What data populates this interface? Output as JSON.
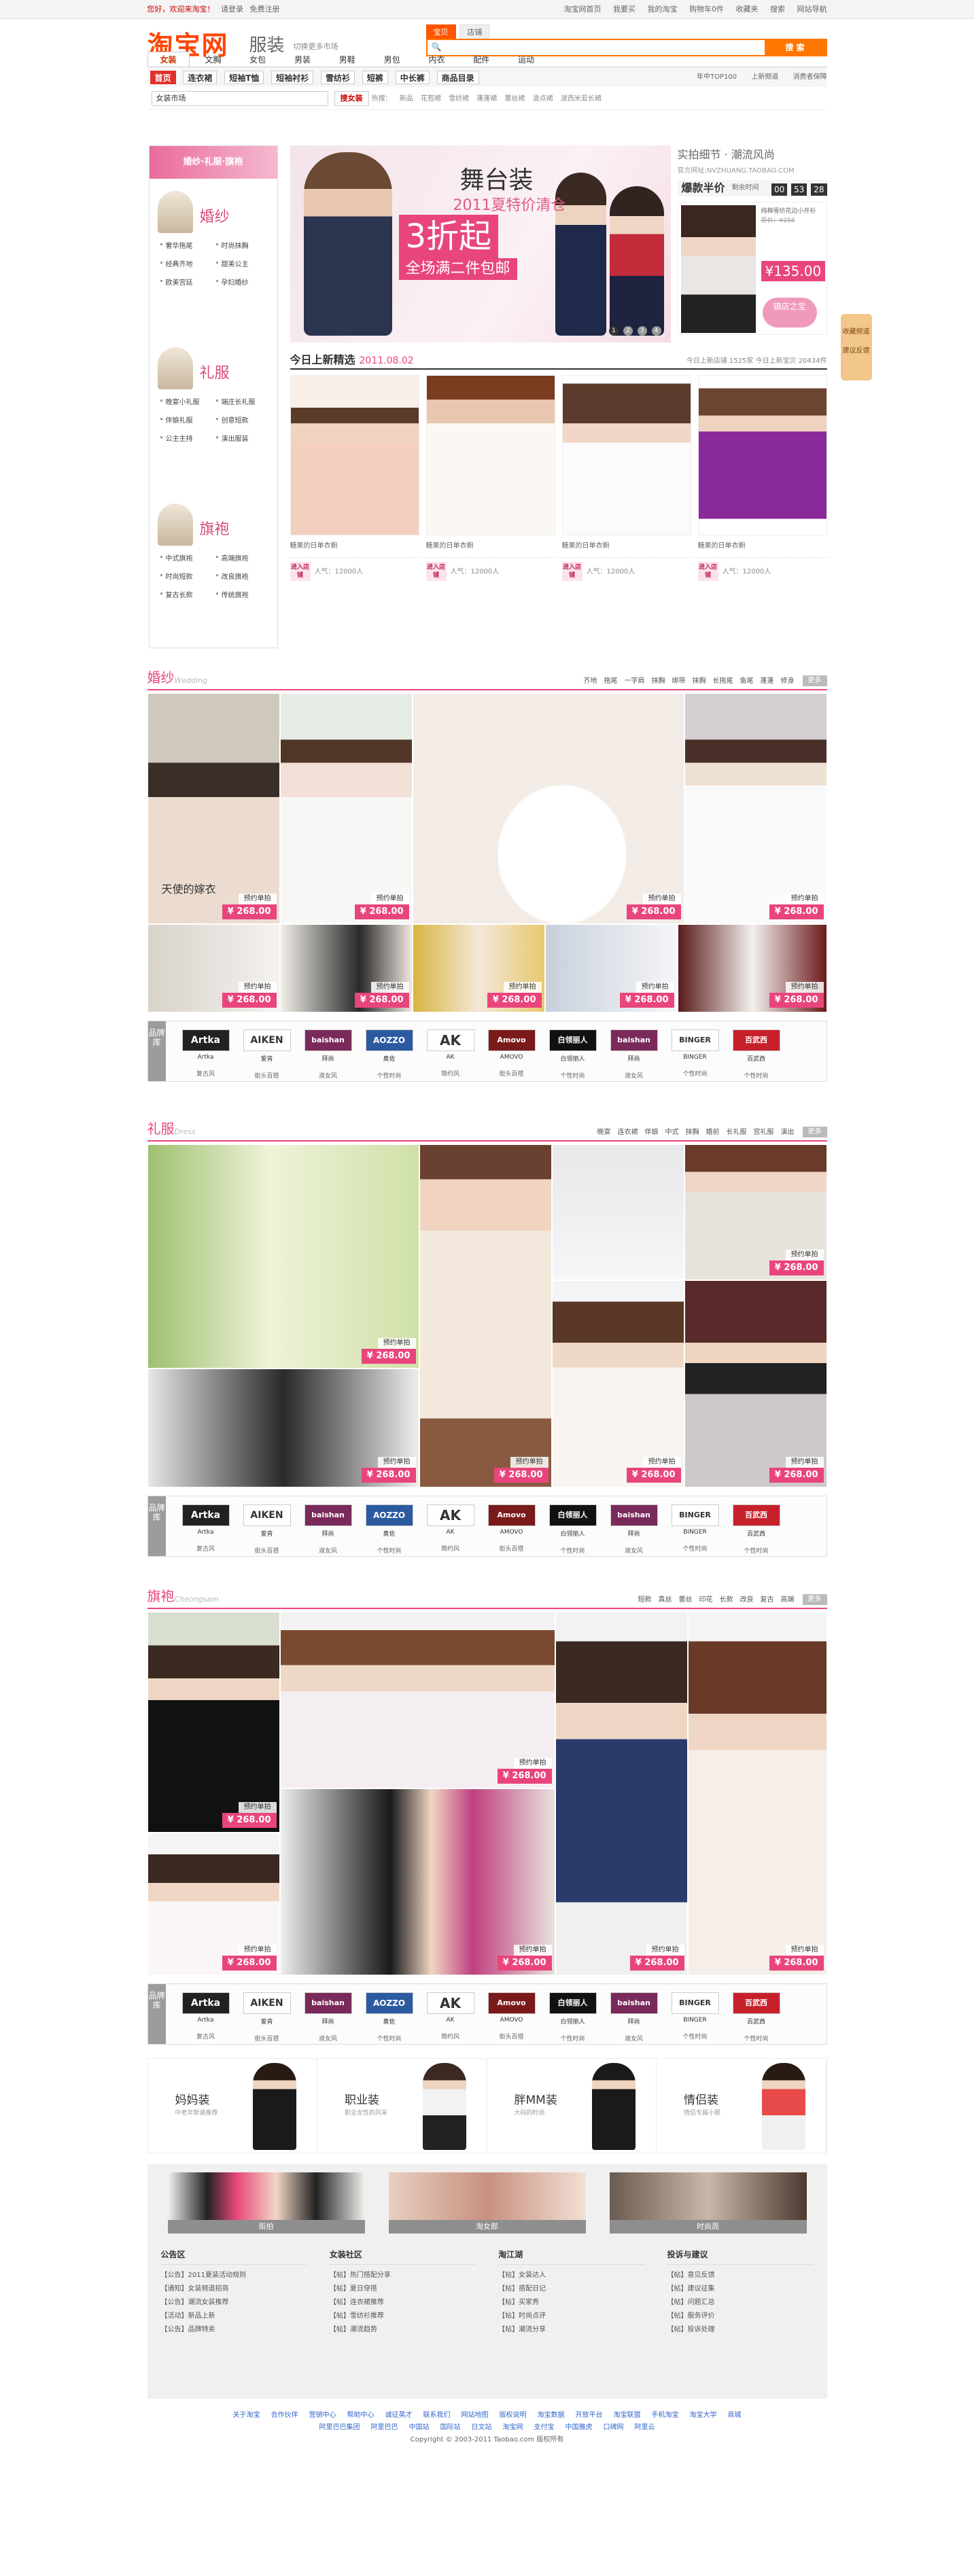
{
  "topbar": {
    "greeting": "您好，欢迎来淘宝！",
    "login": "请登录",
    "register": "免费注册",
    "links": [
      "淘宝网首页",
      "我要买",
      "我的淘宝",
      "购物车0件",
      "收藏夹",
      "搜索",
      "网站导航"
    ]
  },
  "header": {
    "logo": "淘宝网",
    "channel": "服装",
    "switch_market": "切换更多市场",
    "search_tabs": [
      "宝贝",
      "店铺"
    ],
    "search_placeholder": "",
    "search_button": "搜 索"
  },
  "subnav": [
    "女装",
    "文胸",
    "女包",
    "男装",
    "男鞋",
    "男包",
    "内衣",
    "配件",
    "运动"
  ],
  "categories": [
    "首页",
    "连衣裙",
    "短袖T恤",
    "短袖衬衫",
    "雪纺衫",
    "短裤",
    "中长裤",
    "商品目录"
  ],
  "cat_right": [
    "年中TOP100",
    "上新频道",
    "消费者保障"
  ],
  "quickbar": {
    "market": "女装市场",
    "pink": "搜女装",
    "hot_label": "热搜：",
    "hot": [
      "新品",
      "花苞裙",
      "雪纺裙",
      "蓬蓬裙",
      "蕾丝裙",
      "波点裙",
      "波西米亚长裙"
    ]
  },
  "sidebar": {
    "header": "婚纱·礼服·旗袍",
    "groups": [
      {
        "title": "婚纱",
        "items": [
          "奢华拖尾",
          "时尚抹胸",
          "经典齐地",
          "甜美公主",
          "欧美宫廷",
          "孕妇婚纱"
        ]
      },
      {
        "title": "礼服",
        "items": [
          "晚宴小礼服",
          "端庄长礼服",
          "伴娘礼服",
          "创意短款",
          "公主主持",
          "演出服装"
        ]
      },
      {
        "title": "旗袍",
        "items": [
          "中式旗袍",
          "高端旗袍",
          "时尚短款",
          "改良旗袍",
          "复古长款",
          "传统旗袍"
        ]
      }
    ]
  },
  "banner": {
    "title": "舞台装",
    "subtitle": "2011夏特价清仓",
    "discount": "3折起",
    "promo": "全场满二件包邮",
    "pages": [
      "1",
      "2",
      "3",
      "4"
    ]
  },
  "shop": {
    "title": "实拍细节 · 潮流风尚",
    "url": "官方网址:NVZHUANG.TAOBAO.COM",
    "burst": "爆款半价",
    "countdown_label": "剩余时间",
    "countdown": [
      "00",
      "53",
      "28"
    ],
    "desc": "纯棉雪纺花边小开衫",
    "orig": "原价：¥258",
    "price": "¥135.00",
    "btn": "镇店之宝"
  },
  "side_tag": {
    "lines": [
      "收藏频道",
      "建议反馈"
    ]
  },
  "new_section": {
    "title": "今日上新精选",
    "date": "2011.08.02",
    "stats": "今日上新店铺 1525家   今日上新宝贝 20434件",
    "items": [
      {
        "caption": "糖果的日单衣橱",
        "btn": "进入店铺",
        "pop": "人气：12000人"
      },
      {
        "caption": "糖果的日单衣橱",
        "btn": "进入店铺",
        "pop": "人气：12000人"
      },
      {
        "caption": "糖果的日单衣橱",
        "btn": "进入店铺",
        "pop": "人气：12000人"
      },
      {
        "caption": "糖果的日单衣橱",
        "btn": "进入店铺",
        "pop": "人气：12000人"
      }
    ]
  },
  "wedding": {
    "title": "婚纱",
    "en": "Wedding",
    "links": [
      "齐地",
      "拖尾",
      "一字肩",
      "抹胸",
      "绑带",
      "抹胸",
      "长拖尾",
      "鱼尾",
      "蓬蓬",
      "修身"
    ],
    "more": "更多",
    "mark": "天使的嫁衣",
    "tag": "预约单拍",
    "price": "¥ 268.00"
  },
  "dress": {
    "title": "礼服",
    "en": "Dress",
    "links": [
      "晚宴",
      "连衣裙",
      "伴娘",
      "中式",
      "抹胸",
      "婚前",
      "长礼服",
      "宫礼服",
      "演出"
    ],
    "more": "更多",
    "tag": "预约单拍",
    "price": "¥ 268.00"
  },
  "qipao": {
    "title": "旗袍",
    "en": "Cheongsam",
    "links": [
      "短款",
      "真丝",
      "蕾丝",
      "印花",
      "长款",
      "改良",
      "复古",
      "高端"
    ],
    "more": "更多",
    "tag": "预约单拍",
    "price": "¥ 268.00"
  },
  "brands": {
    "label": "品牌库",
    "list": [
      {
        "logo": "Artka",
        "n1": "Artka",
        "n2": "复古风"
      },
      {
        "logo": "AIKEN",
        "n1": "爱肯",
        "n2": "街头百搭"
      },
      {
        "logo": "baishan",
        "n1": "拜尚",
        "n2": "淑女风"
      },
      {
        "logo": "AOZZO",
        "n1": "奥佐",
        "n2": "个性时尚"
      },
      {
        "logo": "AK",
        "n1": "AK",
        "n2": "简约风"
      },
      {
        "logo": "Amovo",
        "n1": "AMOVO",
        "n2": "街头百搭"
      },
      {
        "logo": "白领丽人",
        "n1": "白领丽人",
        "n2": "个性时尚"
      },
      {
        "logo": "baishan",
        "n1": "拜尚",
        "n2": "淑女风"
      },
      {
        "logo": "BINGER",
        "n1": "BINGER",
        "n2": "个性时尚"
      },
      {
        "logo": "百武西",
        "n1": "百武西",
        "n2": "个性时尚"
      }
    ]
  },
  "styles": [
    {
      "name": "妈妈装",
      "desc": "中老年新装推荐"
    },
    {
      "name": "职业装",
      "desc": "职业女性的风采"
    },
    {
      "name": "胖MM装",
      "desc": "大码的时尚"
    },
    {
      "name": "情侣装",
      "desc": "情侣专属小屋"
    }
  ],
  "features": [
    "街拍",
    "淘女郎",
    "时尚周"
  ],
  "boards": [
    {
      "title": "公告区",
      "items": [
        "【公告】2011夏装活动规则",
        "【通知】女装频道招商",
        "【公告】潮流女装推荐",
        "【活动】新品上新",
        "【公告】品牌特卖"
      ]
    },
    {
      "title": "女装社区",
      "items": [
        "【帖】热门搭配分享",
        "【帖】夏日穿搭",
        "【帖】连衣裙推荐",
        "【帖】雪纺衫推荐",
        "【帖】潮流趋势"
      ]
    },
    {
      "title": "淘江湖",
      "items": [
        "【帖】女装达人",
        "【帖】搭配日记",
        "【帖】买家秀",
        "【帖】时尚点评",
        "【帖】潮流分享"
      ]
    },
    {
      "title": "投诉与建议",
      "items": [
        "【帖】意见反馈",
        "【帖】建议征集",
        "【帖】问题汇总",
        "【帖】服务评价",
        "【帖】投诉处理"
      ]
    }
  ],
  "footer": {
    "row1": [
      "关于淘宝",
      "合作伙伴",
      "营销中心",
      "帮助中心",
      "诚征英才",
      "联系我们",
      "网站地图",
      "版权说明",
      "淘宝数据",
      "开放平台",
      "淘宝联盟",
      "手机淘宝",
      "淘宝大学",
      "商城"
    ],
    "row2": [
      "阿里巴巴集团",
      "阿里巴巴",
      "中国站",
      "国际站",
      "日文站",
      "淘宝网",
      "支付宝",
      "中国雅虎",
      "口碑网",
      "阿里云"
    ],
    "copyright": "Copyright © 2003-2011 Taobao.com 版权所有"
  },
  "colors": {
    "accent": "#e9457d",
    "orange": "#f70"
  }
}
